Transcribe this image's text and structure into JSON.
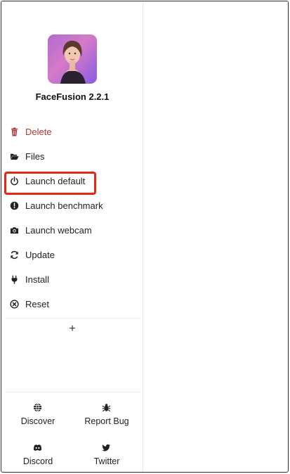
{
  "app": {
    "title": "FaceFusion 2.2.1",
    "icon": "facefusion-app-icon"
  },
  "menu": [
    {
      "label": "Delete",
      "icon": "trash-icon"
    },
    {
      "label": "Files",
      "icon": "folder-open-icon"
    },
    {
      "label": "Launch default",
      "icon": "power-icon",
      "selected": true
    },
    {
      "label": "Launch benchmark",
      "icon": "gauge-icon"
    },
    {
      "label": "Launch webcam",
      "icon": "camera-icon"
    },
    {
      "label": "Update",
      "icon": "refresh-icon"
    },
    {
      "label": "Install",
      "icon": "plug-icon"
    },
    {
      "label": "Reset",
      "icon": "circle-x-icon"
    }
  ],
  "add_symbol": "+",
  "footer": [
    {
      "label": "Discover",
      "icon": "globe-icon"
    },
    {
      "label": "Report Bug",
      "icon": "bug-icon"
    },
    {
      "label": "Discord",
      "icon": "discord-icon"
    },
    {
      "label": "Twitter",
      "icon": "twitter-icon"
    }
  ],
  "colors": {
    "delete": "#b03a3a",
    "highlight": "#e02a16"
  }
}
